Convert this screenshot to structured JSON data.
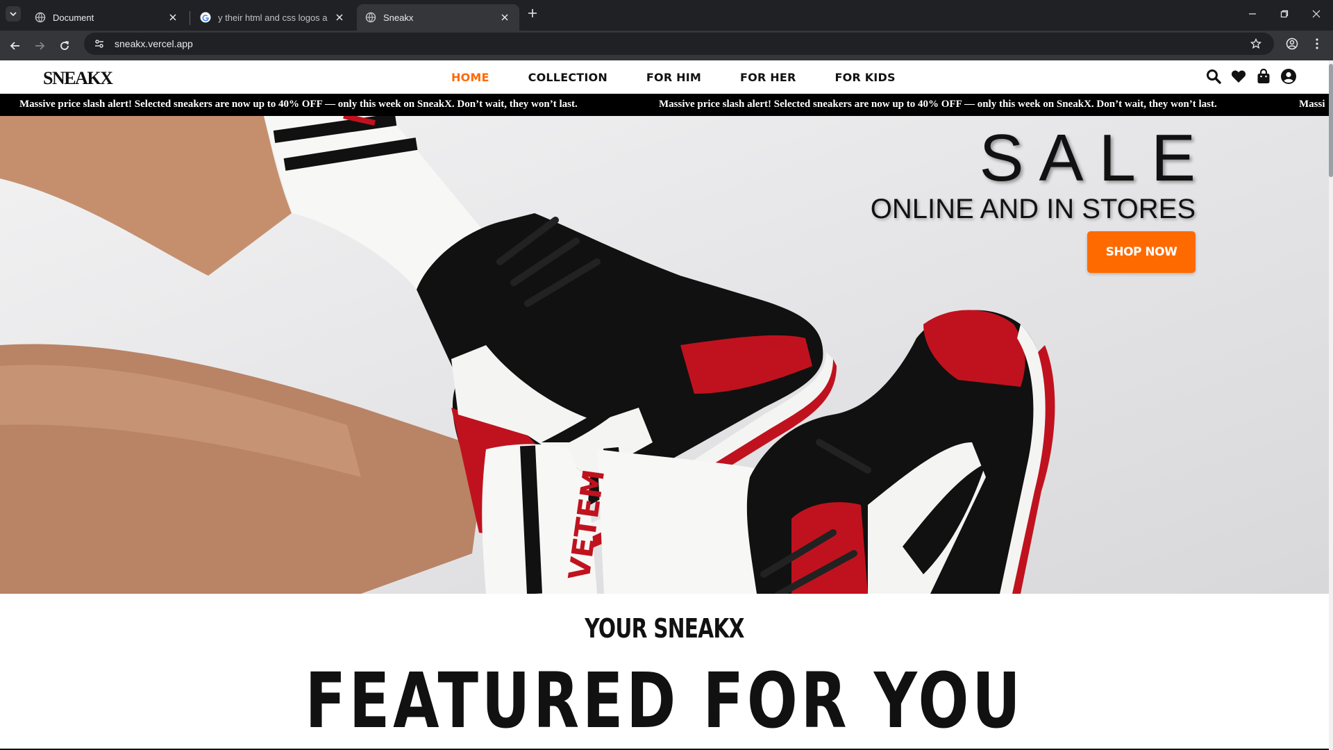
{
  "browser": {
    "tabs": [
      {
        "title": "Document",
        "active": false,
        "icon": "globe-icon"
      },
      {
        "title": "y their html and css logos are li",
        "active": false,
        "icon": "google-icon"
      },
      {
        "title": "Sneakx",
        "active": true,
        "icon": "globe-icon"
      }
    ],
    "url": "sneakx.vercel.app"
  },
  "site": {
    "logo": "SNEAKX",
    "nav": [
      {
        "label": "HOME",
        "active": true
      },
      {
        "label": "COLLECTION",
        "active": false
      },
      {
        "label": "FOR HIM",
        "active": false
      },
      {
        "label": "FOR HER",
        "active": false
      },
      {
        "label": "FOR KIDS",
        "active": false
      }
    ],
    "header_icons": [
      "search-icon",
      "heart-icon",
      "bag-icon",
      "account-icon"
    ],
    "ticker_text": "Massive price slash alert! Selected sneakers are now up to 40% OFF — only this week on SneakX. Don’t wait, they won’t last.",
    "ticker_fragment": "Massi",
    "hero": {
      "title": "SALE",
      "subtitle": "ONLINE AND IN STORES",
      "cta": "SHOP NOW",
      "sock_text": "VETEM"
    },
    "featured": {
      "kicker": "YOUR SNEAKX",
      "heading": "FEATURED FOR YOU"
    }
  },
  "colors": {
    "accent": "#ff6a00",
    "chrome_dark": "#202124",
    "chrome_tab": "#35363a",
    "shoe_red": "#c0121e",
    "shoe_black": "#111111"
  }
}
